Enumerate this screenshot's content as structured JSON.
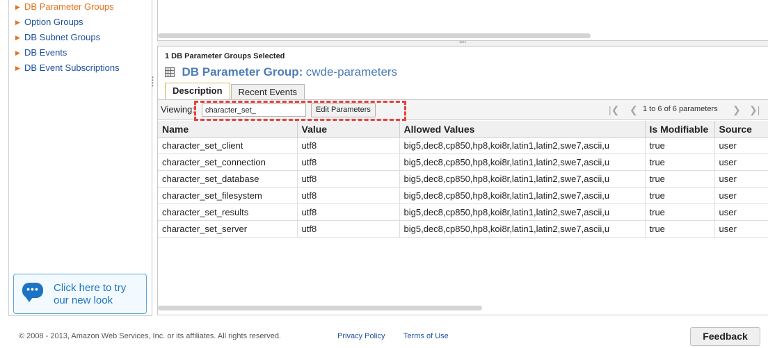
{
  "sidebar": {
    "items": [
      {
        "label": "DB Parameter Groups"
      },
      {
        "label": "Option Groups"
      },
      {
        "label": "DB Subnet Groups"
      },
      {
        "label": "DB Events"
      },
      {
        "label": "DB Event Subscriptions"
      }
    ],
    "try_new_look": "Click here to try our new look"
  },
  "detail": {
    "selected_text": "1 DB Parameter Groups Selected",
    "title_label": "DB Parameter Group:",
    "title_name": "cwde-parameters",
    "tabs": [
      {
        "label": "Description"
      },
      {
        "label": "Recent Events"
      }
    ],
    "toolbar": {
      "viewing_label": "Viewing:",
      "filter_value": "character_set_",
      "edit_button": "Edit Parameters",
      "pager_text": "1 to 6 of 6 parameters"
    },
    "table": {
      "columns": [
        "Name",
        "Value",
        "Allowed Values",
        "Is Modifiable",
        "Source"
      ],
      "rows": [
        {
          "name": "character_set_client",
          "value": "utf8",
          "allowed": "big5,dec8,cp850,hp8,koi8r,latin1,latin2,swe7,ascii,u",
          "modifiable": "true",
          "source": "user"
        },
        {
          "name": "character_set_connection",
          "value": "utf8",
          "allowed": "big5,dec8,cp850,hp8,koi8r,latin1,latin2,swe7,ascii,u",
          "modifiable": "true",
          "source": "user"
        },
        {
          "name": "character_set_database",
          "value": "utf8",
          "allowed": "big5,dec8,cp850,hp8,koi8r,latin1,latin2,swe7,ascii,u",
          "modifiable": "true",
          "source": "user"
        },
        {
          "name": "character_set_filesystem",
          "value": "utf8",
          "allowed": "big5,dec8,cp850,hp8,koi8r,latin1,latin2,swe7,ascii,u",
          "modifiable": "true",
          "source": "user"
        },
        {
          "name": "character_set_results",
          "value": "utf8",
          "allowed": "big5,dec8,cp850,hp8,koi8r,latin1,latin2,swe7,ascii,u",
          "modifiable": "true",
          "source": "user"
        },
        {
          "name": "character_set_server",
          "value": "utf8",
          "allowed": "big5,dec8,cp850,hp8,koi8r,latin1,latin2,swe7,ascii,u",
          "modifiable": "true",
          "source": "user"
        }
      ]
    }
  },
  "footer": {
    "copyright": "© 2008 - 2013, Amazon Web Services, Inc. or its affiliates. All rights reserved.",
    "privacy": "Privacy Policy",
    "terms": "Terms of Use",
    "feedback": "Feedback"
  },
  "colors": {
    "link_blue": "#1c4f9c",
    "active_orange": "#e3731d",
    "title_blue": "#4d7db8",
    "highlight_red": "#e8403a"
  },
  "icons": {
    "nav_arrow": "chevron-right-icon",
    "chat": "chat-bubble-icon",
    "grid": "grid-icon",
    "pager": [
      "first-page-icon",
      "prev-page-icon",
      "next-page-icon",
      "last-page-icon"
    ]
  }
}
